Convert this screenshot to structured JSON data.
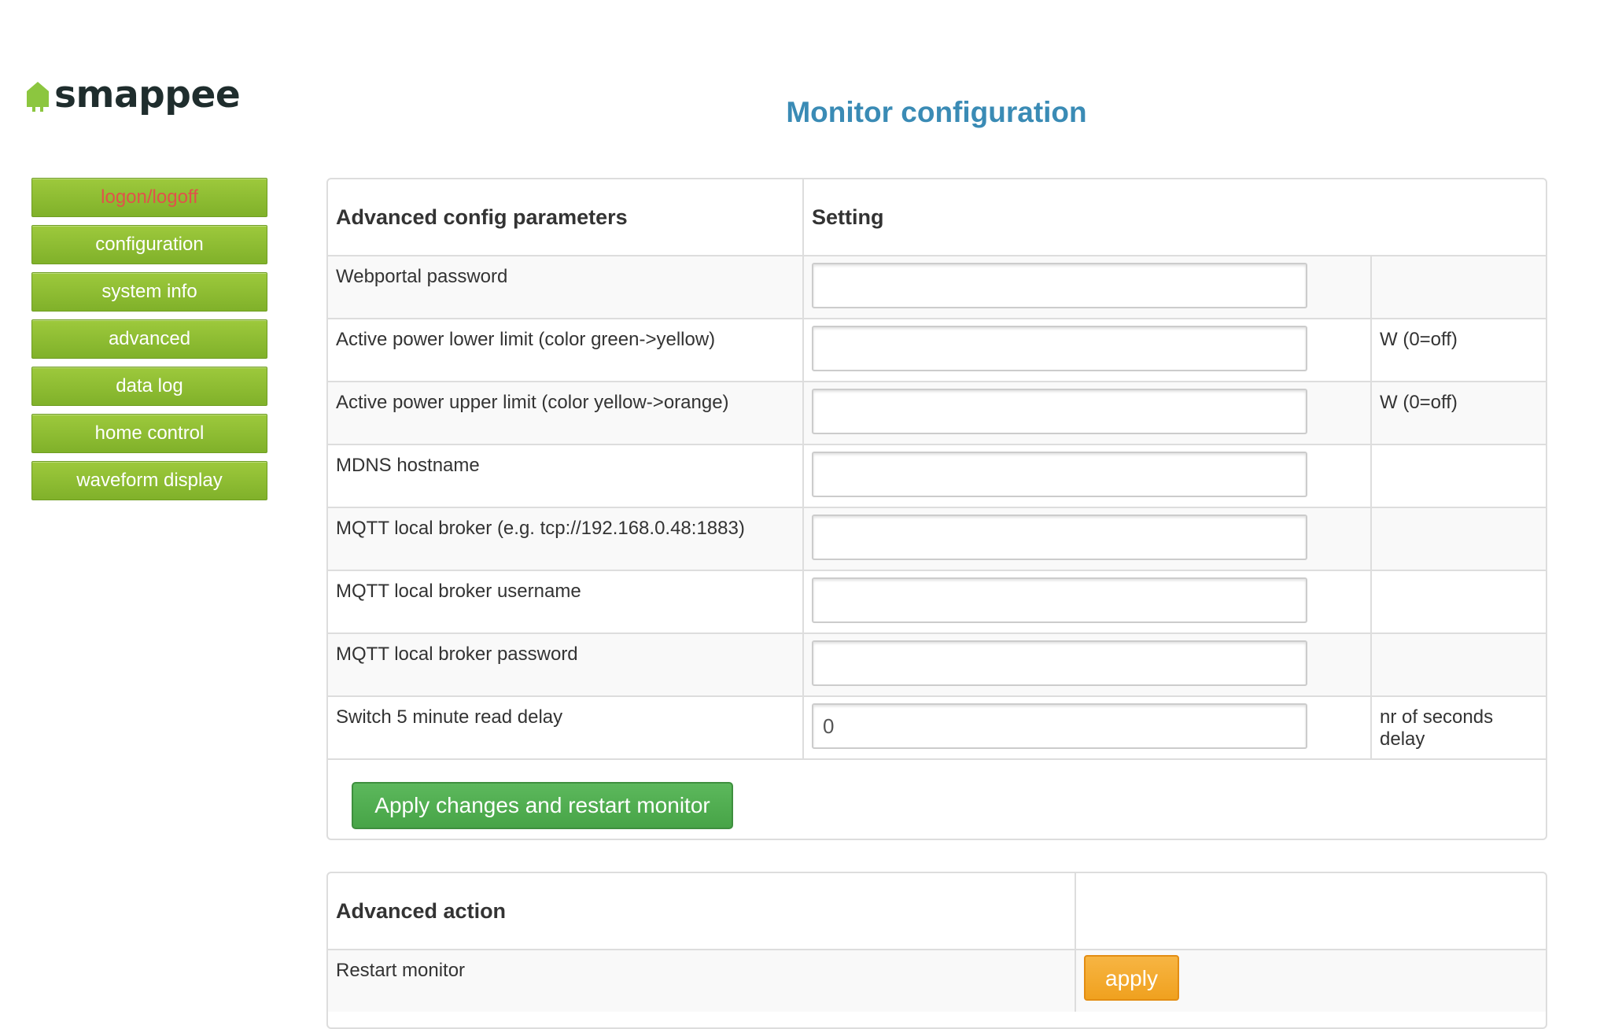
{
  "brand": {
    "name": "smappee",
    "color": "#8cc63f"
  },
  "page": {
    "title": "Monitor configuration"
  },
  "nav": {
    "items": [
      {
        "label": "logon/logoff",
        "active": true
      },
      {
        "label": "configuration"
      },
      {
        "label": "system info"
      },
      {
        "label": "advanced"
      },
      {
        "label": "data log"
      },
      {
        "label": "home control"
      },
      {
        "label": "waveform display"
      }
    ]
  },
  "config": {
    "header_param": "Advanced config parameters",
    "header_setting": "Setting",
    "rows": [
      {
        "label": "Webportal password",
        "value": "",
        "unit": ""
      },
      {
        "label": "Active power lower limit (color green->yellow)",
        "value": "",
        "unit": "W (0=off)"
      },
      {
        "label": "Active power upper limit (color yellow->orange)",
        "value": "",
        "unit": "W (0=off)"
      },
      {
        "label": "MDNS hostname",
        "value": "",
        "unit": ""
      },
      {
        "label": "MQTT local broker (e.g. tcp://192.168.0.48:1883)",
        "value": "",
        "unit": ""
      },
      {
        "label": "MQTT local broker username",
        "value": "",
        "unit": ""
      },
      {
        "label": "MQTT local broker password",
        "value": "",
        "unit": ""
      },
      {
        "label": "Switch 5 minute read delay",
        "value": "0",
        "unit": "nr of seconds delay"
      }
    ],
    "apply_label": "Apply changes and restart monitor"
  },
  "actions": {
    "header": "Advanced action",
    "rows": [
      {
        "label": "Restart monitor",
        "button": "apply"
      }
    ]
  },
  "colors": {
    "nav_green": "#8cc63f",
    "title_blue": "#3a8bb5",
    "apply_green": "#5cb85c",
    "apply_orange": "#f0ad4e",
    "active_nav_text": "#e0524a"
  }
}
